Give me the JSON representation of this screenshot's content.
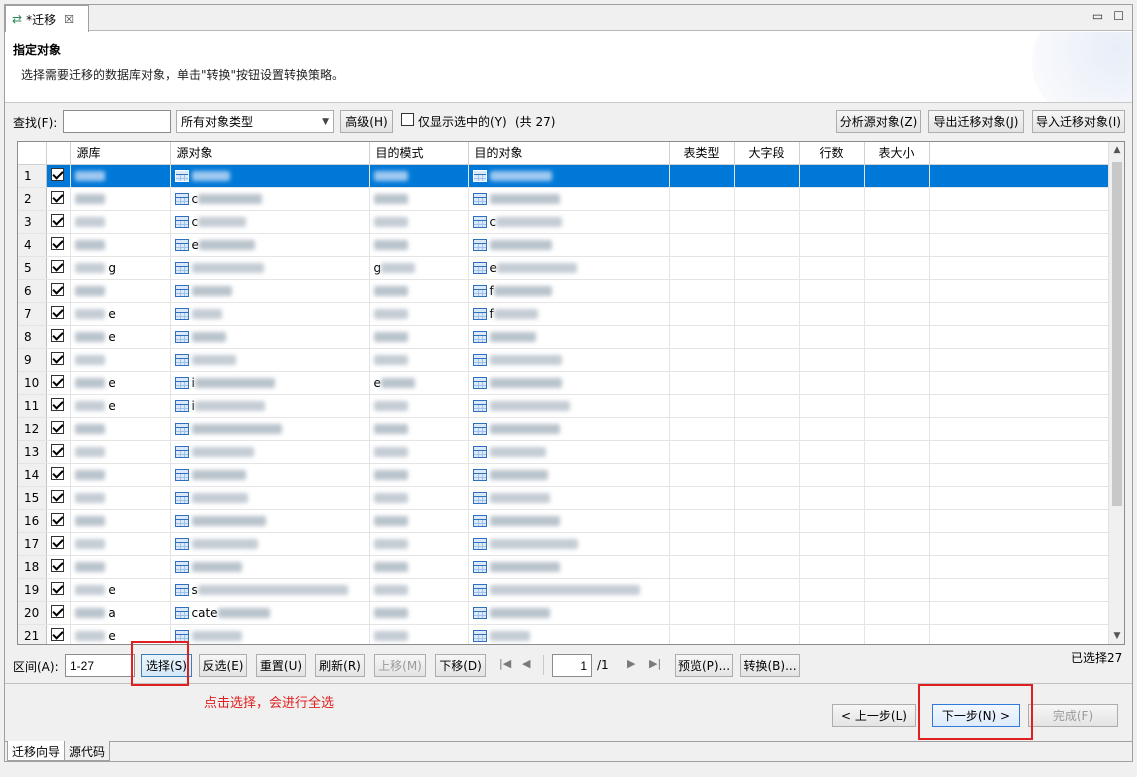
{
  "window": {
    "tab_title": "*迁移",
    "close_glyph": "☒",
    "minimize_glyph": "▭",
    "maximize_glyph": "☐"
  },
  "header": {
    "title": "指定对象",
    "description": "选择需要迁移的数据库对象，单击\"转换\"按钮设置转换策略。"
  },
  "toolbar": {
    "search_label": "查找(F):",
    "search_value": "",
    "type_filter": "所有对象类型",
    "advanced_button": "高级(H)",
    "only_selected_label": "仅显示选中的(Y)",
    "count_text": "(共 27)",
    "analyze_button": "分析源对象(Z)",
    "export_button": "导出迁移对象(J)",
    "import_button": "导入迁移对象(I)"
  },
  "table": {
    "columns": [
      "",
      "",
      "源库",
      "源对象",
      "目的模式",
      "目的对象",
      "表类型",
      "大字段",
      "行数",
      "表大小"
    ],
    "rows": [
      {
        "n": "1",
        "src_db_hint": "",
        "src_obj": "",
        "dst_schema": "",
        "dst_obj": ""
      },
      {
        "n": "2",
        "src_db_hint": "",
        "src_obj": "c",
        "dst_schema": "",
        "dst_obj": ""
      },
      {
        "n": "3",
        "src_db_hint": "",
        "src_obj": "c",
        "dst_schema": "",
        "dst_obj": "c"
      },
      {
        "n": "4",
        "src_db_hint": "",
        "src_obj": "e",
        "dst_schema": "",
        "dst_obj": ""
      },
      {
        "n": "5",
        "src_db_hint": "g",
        "src_obj": "",
        "dst_schema": "g",
        "dst_obj": "e"
      },
      {
        "n": "6",
        "src_db_hint": "",
        "src_obj": "",
        "dst_schema": "",
        "dst_obj": "f"
      },
      {
        "n": "7",
        "src_db_hint": "e",
        "src_obj": "",
        "dst_schema": "",
        "dst_obj": "f"
      },
      {
        "n": "8",
        "src_db_hint": "e",
        "src_obj": "",
        "dst_schema": "",
        "dst_obj": ""
      },
      {
        "n": "9",
        "src_db_hint": "",
        "src_obj": "",
        "dst_schema": "",
        "dst_obj": ""
      },
      {
        "n": "10",
        "src_db_hint": "e",
        "src_obj": "i",
        "dst_schema": "e",
        "dst_obj": ""
      },
      {
        "n": "11",
        "src_db_hint": "e",
        "src_obj": "i",
        "dst_schema": "",
        "dst_obj": ""
      },
      {
        "n": "12",
        "src_db_hint": "",
        "src_obj": "",
        "dst_schema": "",
        "dst_obj": ""
      },
      {
        "n": "13",
        "src_db_hint": "",
        "src_obj": "",
        "dst_schema": "",
        "dst_obj": ""
      },
      {
        "n": "14",
        "src_db_hint": "",
        "src_obj": "",
        "dst_schema": "",
        "dst_obj": ""
      },
      {
        "n": "15",
        "src_db_hint": "",
        "src_obj": "",
        "dst_schema": "",
        "dst_obj": ""
      },
      {
        "n": "16",
        "src_db_hint": "",
        "src_obj": "",
        "dst_schema": "",
        "dst_obj": ""
      },
      {
        "n": "17",
        "src_db_hint": "",
        "src_obj": "",
        "dst_schema": "",
        "dst_obj": ""
      },
      {
        "n": "18",
        "src_db_hint": "",
        "src_obj": "",
        "dst_schema": "",
        "dst_obj": ""
      },
      {
        "n": "19",
        "src_db_hint": "e",
        "src_obj": "s",
        "dst_schema": "",
        "dst_obj": ""
      },
      {
        "n": "20",
        "src_db_hint": "a",
        "src_obj": "cate",
        "dst_schema": "",
        "dst_obj": ""
      },
      {
        "n": "21",
        "src_db_hint": "e",
        "src_obj": "",
        "dst_schema": "",
        "dst_obj": ""
      }
    ]
  },
  "bottom": {
    "range_label": "区间(A):",
    "range_value": "1-27",
    "select_button": "选择(S)",
    "invert_button": "反选(E)",
    "reset_button": "重置(U)",
    "refresh_button": "刷新(R)",
    "up_button": "上移(M)",
    "down_button": "下移(D)",
    "page_value": "1",
    "page_total": "/1",
    "preview_button": "预览(P)...",
    "convert_button": "转换(B)...",
    "selected_count": "已选择27"
  },
  "annotation": {
    "text": "点击选择，会进行全选",
    "color": "#e02020"
  },
  "footer": {
    "prev_button": "< 上一步(L)",
    "next_button": "下一步(N) >",
    "finish_button": "完成(F)"
  },
  "bottom_tabs": [
    "迁移向导",
    "源代码"
  ],
  "colors": {
    "selection": "#0078d7",
    "accent_green": "#2e8b57"
  }
}
